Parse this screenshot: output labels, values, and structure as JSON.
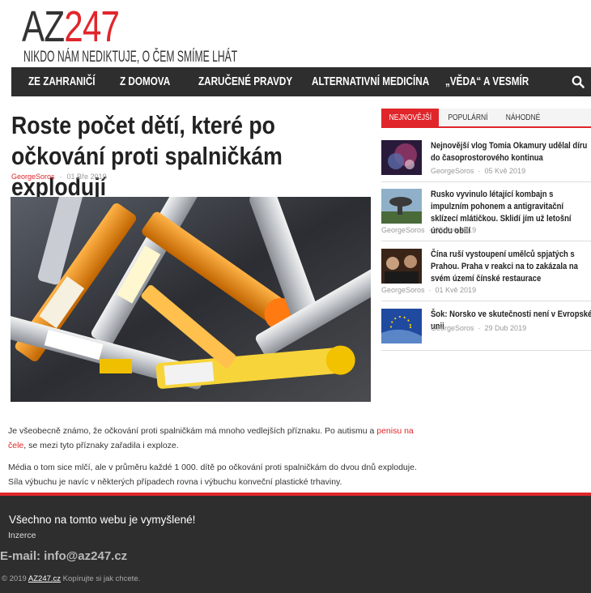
{
  "site": {
    "logo_prefix": "AZ",
    "logo_number": "247",
    "tagline": "NIKDO NÁM NEDIKTUJE, O ČEM SMÍME LHÁT"
  },
  "nav": {
    "items": [
      "ZE ZAHRANIČÍ",
      "Z DOMOVA",
      "ZARUČENÉ PRAVDY",
      "ALTERNATIVNÍ MEDICÍNA",
      "„VĚDA“ A VESMÍR"
    ],
    "search_icon": "search-icon"
  },
  "article": {
    "title": "Roste počet dětí, které po očkování proti spalničkám explodují",
    "author": "GeorgeSoros",
    "date": "01 Bře 2019",
    "p1_before": "Je všeobecně známo, že očkování proti spalničkám má mnoho vedlejších příznaku. Po autismu a ",
    "p1_link": "penisu na čele",
    "p1_after": ", se mezi tyto příznaky zařadila i exploze.",
    "p2": "Média o tom sice mlčí, ale v průměru každé 1 000. dítě po očkování proti spalničkám do dvou dnů exploduje. Síla výbuchu je navíc v některých případech rovna i výbuchu konveční plastické trhaviny."
  },
  "sidebar": {
    "tabs": [
      "NEJNOVĚJŠÍ",
      "POPULÁRNÍ",
      "NÁHODNÉ"
    ],
    "items": [
      {
        "title": "Nejnovější vlog Tomia Okamury udělal díru do časoprostorového kontinua",
        "author": "GeorgeSoros",
        "date": "05 Kvě 2019"
      },
      {
        "title": "Rusko vyvinulo létající kombajn s impulzním pohonem a antigravitační sklízecí mlátičkou. Sklidí jím už letošní úrodu obilí",
        "author": "GeorgeSoros",
        "date": "05 Kvě 2019"
      },
      {
        "title": "Čína ruší vystoupení umělců spjatých s Prahou. Praha v reakci na to zakázala na svém území čínské restaurace",
        "author": "GeorgeSoros",
        "date": "01 Kvě 2019"
      },
      {
        "title": "Šok: Norsko ve skutečnosti není v Evropské unii",
        "author": "GeorgeSoros",
        "date": "29 Dub 2019"
      }
    ]
  },
  "footer": {
    "disclaimer": "Všechno na tomto webu je vymyšlené!",
    "ads": "Inzerce",
    "email": "E-mail: info@az247.cz",
    "copy_prefix": "© 2019 ",
    "copy_link": "AZ247.cz",
    "copy_suffix": " Kopírujte si jak chcete."
  },
  "colors": {
    "accent": "#e0262b",
    "dark": "#2e2e2e"
  }
}
